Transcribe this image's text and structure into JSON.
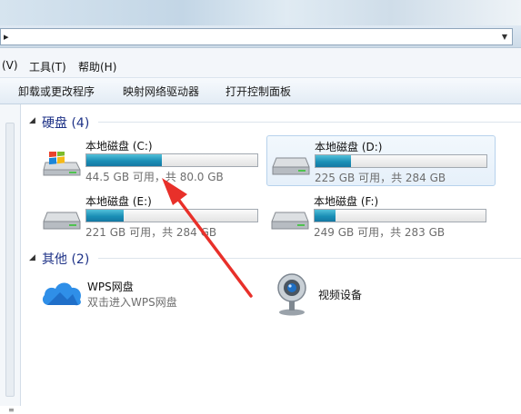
{
  "address": {
    "chevron": "▸",
    "dropdown": "▼"
  },
  "menu": {
    "view": "(V)",
    "tools": "工具(T)",
    "help": "帮助(H)"
  },
  "toolbar": {
    "uninstall": "卸载或更改程序",
    "map_drive": "映射网络驱动器",
    "control_panel": "打开控制面板"
  },
  "groups": {
    "disks": {
      "arrow": "◢",
      "title": "硬盘 (4)"
    },
    "others": {
      "arrow": "◢",
      "title": "其他 (2)"
    }
  },
  "drives": [
    {
      "name": "本地磁盘 (C:)",
      "space": "44.5 GB 可用，共 80.0 GB",
      "used_fraction": 0.44,
      "icon": "windows-drive-icon"
    },
    {
      "name": "本地磁盘 (D:)",
      "space": "225 GB 可用，共 284 GB",
      "used_fraction": 0.21,
      "icon": "hard-drive-icon"
    },
    {
      "name": "本地磁盘 (E:)",
      "space": "221 GB 可用，共 284 GB",
      "used_fraction": 0.22,
      "icon": "hard-drive-icon"
    },
    {
      "name": "本地磁盘 (F:)",
      "space": "249 GB 可用，共 283 GB",
      "used_fraction": 0.12,
      "icon": "hard-drive-icon"
    }
  ],
  "others": [
    {
      "name": "WPS网盘",
      "sub": "双击进入WPS网盘",
      "icon": "wps-cloud-icon"
    },
    {
      "name": "视频设备",
      "sub": "",
      "icon": "webcam-icon"
    }
  ],
  "colors": {
    "group_title": "#1e3287",
    "drive_bar": "#1b8fb6",
    "annotation_arrow": "#e8302a",
    "selection": "#e6f0fa"
  }
}
